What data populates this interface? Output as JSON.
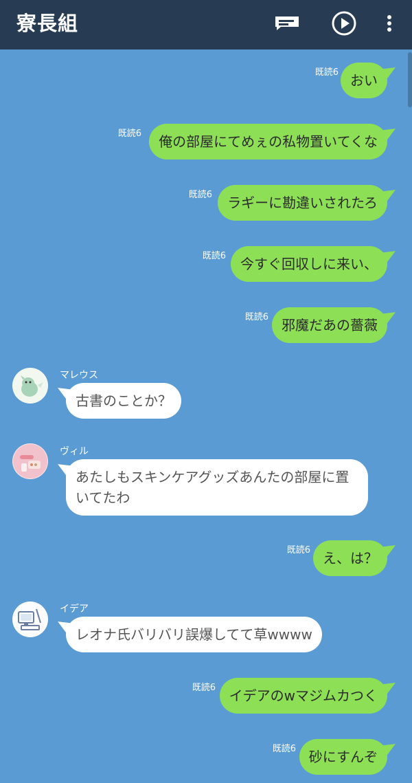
{
  "header": {
    "title": "寮長組",
    "icons": [
      "notes-icon",
      "play-icon",
      "more-icon"
    ]
  },
  "messages": [
    {
      "side": "mine",
      "read": "既読6",
      "text": "おい"
    },
    {
      "side": "mine",
      "read": "既読6",
      "text": "俺の部屋にてめぇの私物置いてくな"
    },
    {
      "side": "mine",
      "read": "既読6",
      "text": "ラギーに勘違いされたろ"
    },
    {
      "side": "mine",
      "read": "既読6",
      "text": "今すぐ回収しに来い、"
    },
    {
      "side": "mine",
      "read": "既読6",
      "text": "邪魔だあの薔薇"
    },
    {
      "side": "theirs",
      "name": "マレウス",
      "text": "古書のことか？"
    },
    {
      "side": "theirs",
      "name": "ヴィル",
      "text": "あたしもスキンケアグッズあんたの部屋に置\nいてたわ"
    },
    {
      "side": "mine",
      "read": "既読6",
      "text": "え、は？"
    },
    {
      "side": "theirs",
      "name": "イデア",
      "text": "レオナ氏バリバリ誤爆してて草wwww"
    },
    {
      "side": "mine",
      "read": "既読6",
      "text": "イデアのwマジムカつく"
    },
    {
      "side": "mine",
      "read": "既読6",
      "text": "砂にすんぞ"
    }
  ],
  "colors": {
    "background": "#5b9bd4",
    "header": "#273c52",
    "my_bubble": "#8de055",
    "their_bubble": "#ffffff"
  }
}
